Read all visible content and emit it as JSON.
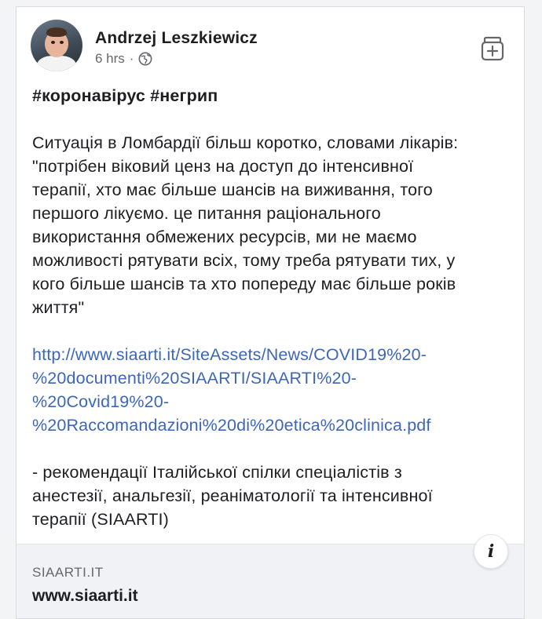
{
  "post": {
    "author": "Andrzej Leszkiewicz",
    "time": "6 hrs",
    "separator": "·",
    "privacy_icon": "globe-icon",
    "save_icon": "save-icon",
    "hashtags": "#коронавірус #негрип",
    "paragraph1": "Ситуація в Ломбардії більш коротко, словами лікарів:\n\"потрібен віковий ценз на доступ до інтенсивної\nтерапії, хто має більше шансів на виживання, того\nпершого лікуємо. це питання раціонального\nвикористання обмежених ресурсів, ми не маємо\nможливості рятувати всіх, тому треба рятувати тих, у\nкого більше шансів та хто попереду має більше років\nжиття\"",
    "link": "http://www.siaarti.it/SiteAssets/News/COVID19%20-\n%20documenti%20SIAARTI/SIAARTI%20-\n%20Covid19%20-\n%20Raccomandazioni%20di%20etica%20clinica.pdf",
    "paragraph2": "- рекомендації Італійської спілки спеціалістів з\nанестезії, анальгезії, реаніматології та інтенсивної\nтерапії (SIAARTI)"
  },
  "link_preview": {
    "domain": "SIAARTI.IT",
    "site": "www.siaarti.it",
    "info_label": "i"
  },
  "colors": {
    "link": "#3d66b8",
    "text": "#1c1e21",
    "meta": "#65676b",
    "preview_bg": "#f0f2f5"
  }
}
